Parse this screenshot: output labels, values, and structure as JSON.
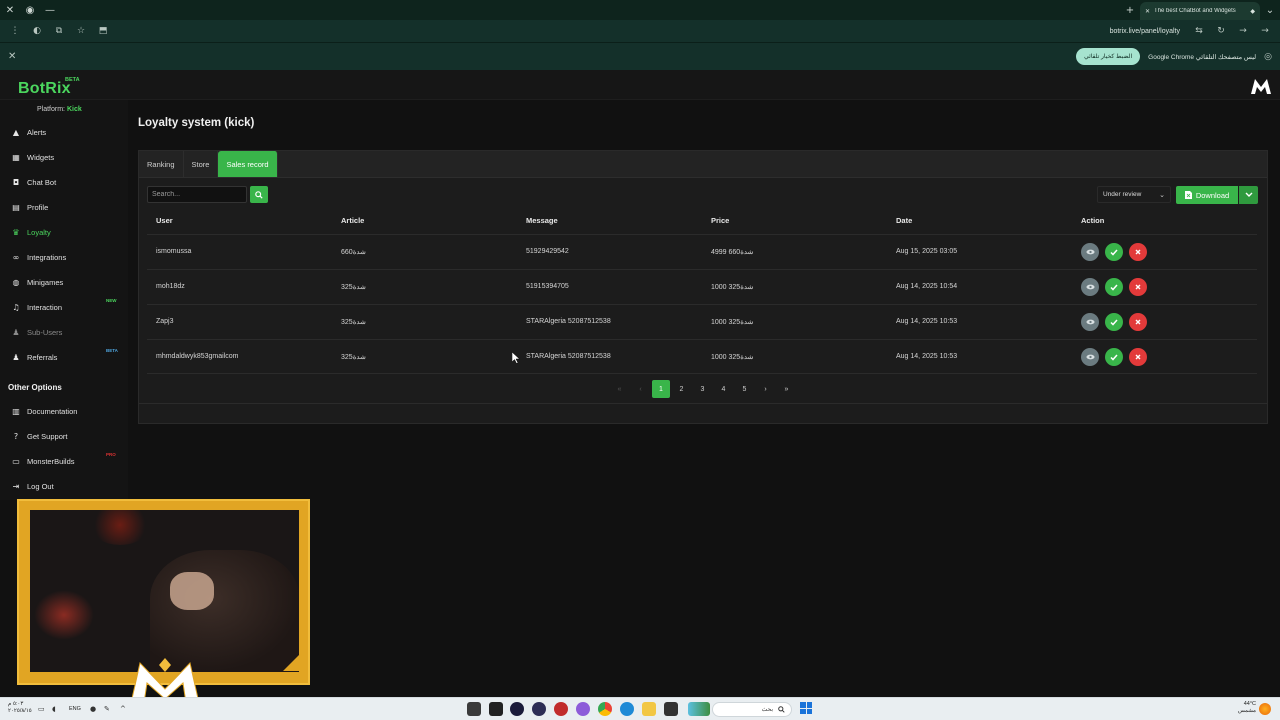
{
  "browser": {
    "tab_title": "The best ChatBot and Widgets",
    "url": "botrix.live/panel/loyalty",
    "infobar_text": "Google Chrome ليس متصفحك التلقائي",
    "infobar_button": "الضبط كخيار تلقائي"
  },
  "app": {
    "logo": "BotRix",
    "logo_badge": "BETA",
    "platform_label": "Platform:",
    "platform_value": "Kick"
  },
  "sidebar": {
    "items": [
      {
        "label": "Alerts",
        "icon": "warning-icon"
      },
      {
        "label": "Widgets",
        "icon": "grid-icon"
      },
      {
        "label": "Chat Bot",
        "icon": "robot-icon"
      },
      {
        "label": "Profile",
        "icon": "id-card-icon"
      },
      {
        "label": "Loyalty",
        "icon": "trophy-icon"
      },
      {
        "label": "Integrations",
        "icon": "link-icon"
      },
      {
        "label": "Minigames",
        "icon": "gamepad-icon"
      },
      {
        "label": "Interaction",
        "icon": "music-icon",
        "badge": "NEW"
      },
      {
        "label": "Sub-Users",
        "icon": "users-icon"
      },
      {
        "label": "Referrals",
        "icon": "users-icon",
        "badge": "BETA"
      }
    ],
    "other_title": "Other Options",
    "other_items": [
      {
        "label": "Documentation",
        "icon": "book-icon"
      },
      {
        "label": "Get Support",
        "icon": "question-icon"
      },
      {
        "label": "MonsterBuilds",
        "icon": "monitor-icon",
        "badge": "PRO"
      },
      {
        "label": "Log Out",
        "icon": "logout-icon"
      }
    ]
  },
  "main": {
    "title": "Loyalty system (kick)",
    "tabs": [
      "Ranking",
      "Store",
      "Sales record"
    ],
    "active_tab": "Sales record",
    "search_placeholder": "Search...",
    "status_filter": "Under review",
    "download_label": "Download",
    "table": {
      "headers": [
        "User",
        "Article",
        "Message",
        "Price",
        "Date",
        "Action"
      ],
      "rows": [
        {
          "user": "ismomussa",
          "article": "660شدة",
          "message": "51929429542",
          "price": "4999 660شدة",
          "date": "Aug 15, 2025 03:05"
        },
        {
          "user": "moh18dz",
          "article": "325شدة",
          "message": "51915394705",
          "price": "1000 325شدة",
          "date": "Aug 14, 2025 10:54"
        },
        {
          "user": "Zapj3",
          "article": "325شدة",
          "message": "STARAlgeria 52087512538",
          "price": "1000 325شدة",
          "date": "Aug 14, 2025 10:53"
        },
        {
          "user": "mhmdaldwyk853gmailcom",
          "article": "325شدة",
          "message": "STARAlgeria 52087512538",
          "price": "1000 325شدة",
          "date": "Aug 14, 2025 10:53"
        }
      ]
    },
    "pagination": {
      "first": "«",
      "prev": "‹",
      "pages": [
        "1",
        "2",
        "3",
        "4",
        "5"
      ],
      "current": "1",
      "next": "›",
      "last": "»"
    }
  },
  "taskbar": {
    "time": "٥:٠٣ م",
    "date": "٢٠٢٥/٨/١٥",
    "lang": "ENG",
    "search_text": "بحث",
    "weather_temp": "44°C",
    "weather_text": "مشمس"
  },
  "colors": {
    "accent": "#39b54a",
    "danger": "#e33a3a",
    "view": "#6b7b80",
    "chrome": "#14302a"
  }
}
